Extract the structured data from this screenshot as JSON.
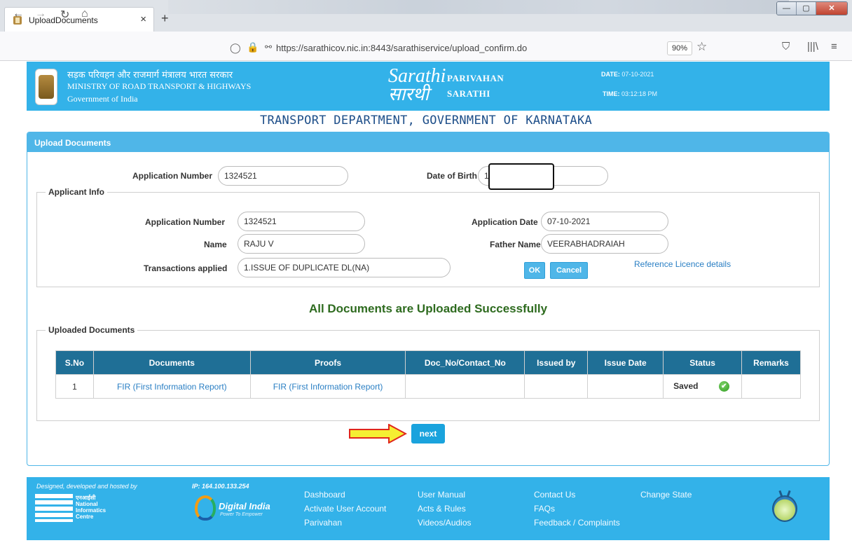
{
  "browser": {
    "tab_title": "UploadDocuments",
    "tab_close": "×",
    "new_tab": "+",
    "url": "https://sarathicov.nic.in:8443/sarathiservice/upload_confirm.do",
    "zoom": "90%"
  },
  "header": {
    "ministry_hindi": "सड़क परिवहन और राजमार्ग मंत्रालय भारत सरकार",
    "ministry_english": "MINISTRY OF ROAD TRANSPORT & HIGHWAYS",
    "government": "Government of India",
    "logo_text_1": "Sarathi",
    "logo_text_2": "सारथी",
    "parivahan": "PARIVAHAN",
    "sarathi": "SARATHI",
    "date_label": "DATE:",
    "date_value": "07-10-2021",
    "time_label": "TIME:",
    "time_value": "03:12:18 PM"
  },
  "department_title": "TRANSPORT DEPARTMENT, GOVERNMENT OF KARNATAKA",
  "panel": {
    "title": "Upload Documents",
    "top_row": {
      "app_no_label": "Application Number",
      "app_no_value": "1324521",
      "dob_label": "Date of Birth",
      "dob_value": "1"
    },
    "applicant_info": {
      "legend": "Applicant Info",
      "app_no_label": "Application Number",
      "app_no_value": "1324521",
      "name_label": "Name",
      "name_value": "RAJU V",
      "transactions_label": "Transactions applied",
      "transactions_value": "1.ISSUE OF DUPLICATE DL(NA)",
      "app_date_label": "Application Date",
      "app_date_value": "07-10-2021",
      "father_label": "Father Name",
      "father_value": "VEERABHADRAIAH",
      "ok_label": "OK",
      "cancel_label": "Cancel",
      "ref_link": "Reference Licence details"
    },
    "success_message": "All Documents are Uploaded Successfully",
    "uploaded": {
      "legend": "Uploaded Documents",
      "columns": [
        "S.No",
        "Documents",
        "Proofs",
        "Doc_No/Contact_No",
        "Issued by",
        "Issue  Date",
        "Status",
        "Remarks"
      ],
      "rows": [
        {
          "sno": "1",
          "document": "FIR (First Information Report)",
          "proof": "FIR (First Information Report)",
          "doc_no": "",
          "issued_by": "",
          "issue_date": "",
          "status": "Saved",
          "remarks": ""
        }
      ]
    },
    "next_label": "next"
  },
  "footer": {
    "designed": "Designed, developed and hosted by",
    "ip": "IP: 164.100.133.254",
    "nic_lines": [
      "एनआईसी",
      "National",
      "Informatics",
      "Centre"
    ],
    "digital_india": "Digital India",
    "digital_india_sub": "Power To Empower",
    "links": [
      "Dashboard",
      "Activate User Account",
      "Parivahan",
      "User Manual",
      "Acts & Rules",
      "Videos/Audios",
      "Contact Us",
      "FAQs",
      "Feedback / Complaints",
      "Change State"
    ]
  },
  "colors": {
    "accent_blue": "#33b2e9",
    "table_header": "#1f6f96",
    "success_green": "#2e6b1f",
    "title_navy": "#1d4e89"
  }
}
